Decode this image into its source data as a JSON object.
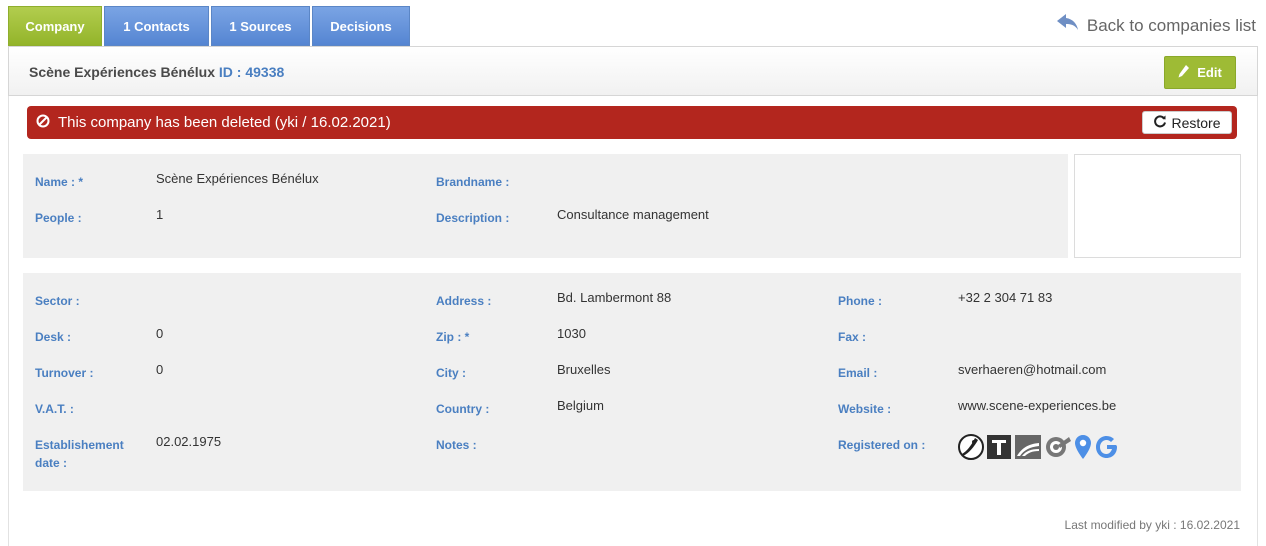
{
  "tabs": [
    {
      "label": "Company",
      "active": true
    },
    {
      "label": "1 Contacts",
      "active": false
    },
    {
      "label": "1 Sources",
      "active": false
    },
    {
      "label": "Decisions",
      "active": false
    }
  ],
  "back_link": "Back to companies list",
  "header": {
    "company_name": "Scène Expériences Bénélux",
    "id_text": "ID : 49338",
    "edit_label": "Edit"
  },
  "banner": {
    "message": "This company has been deleted (yki / 16.02.2021)",
    "restore_label": "Restore"
  },
  "general": {
    "name_label": "Name : *",
    "name_value": "Scène Expériences Bénélux",
    "people_label": "People :",
    "people_value": "1",
    "brandname_label": "Brandname :",
    "brandname_value": "",
    "description_label": "Description :",
    "description_value": "Consultance management"
  },
  "details": {
    "sector_label": "Sector :",
    "sector_value": "",
    "desk_label": "Desk :",
    "desk_value": "0",
    "turnover_label": "Turnover :",
    "turnover_value": "0",
    "vat_label": "V.A.T. :",
    "vat_value": "",
    "establishment_label_1": "Establishement",
    "establishment_label_2": "date :",
    "establishment_value": "02.02.1975",
    "address_label": "Address :",
    "address_value": "Bd. Lambermont 88",
    "zip_label": "Zip : *",
    "zip_value": "1030",
    "city_label": "City :",
    "city_value": "Bruxelles",
    "country_label": "Country :",
    "country_value": "Belgium",
    "notes_label": "Notes :",
    "notes_value": "",
    "phone_label": "Phone :",
    "phone_value": "+32 2 304 71 83",
    "fax_label": "Fax :",
    "fax_value": "",
    "email_label": "Email :",
    "email_value": "sverhaeren@hotmail.com",
    "website_label": "Website :",
    "website_value": "www.scene-experiences.be",
    "registered_label": "Registered on :",
    "registered_icons": [
      "info-registry-icon",
      "t-registry-icon",
      "gazette-icon",
      "graydon-icon",
      "map-pin-icon",
      "google-icon"
    ]
  },
  "footer": {
    "last_modified": "Last modified by yki : 16.02.2021"
  },
  "colors": {
    "tab_active": "#9ebb35",
    "tab_inactive": "#6a97dc",
    "label_blue": "#4a7fc1",
    "banner_red": "#b3261e"
  }
}
